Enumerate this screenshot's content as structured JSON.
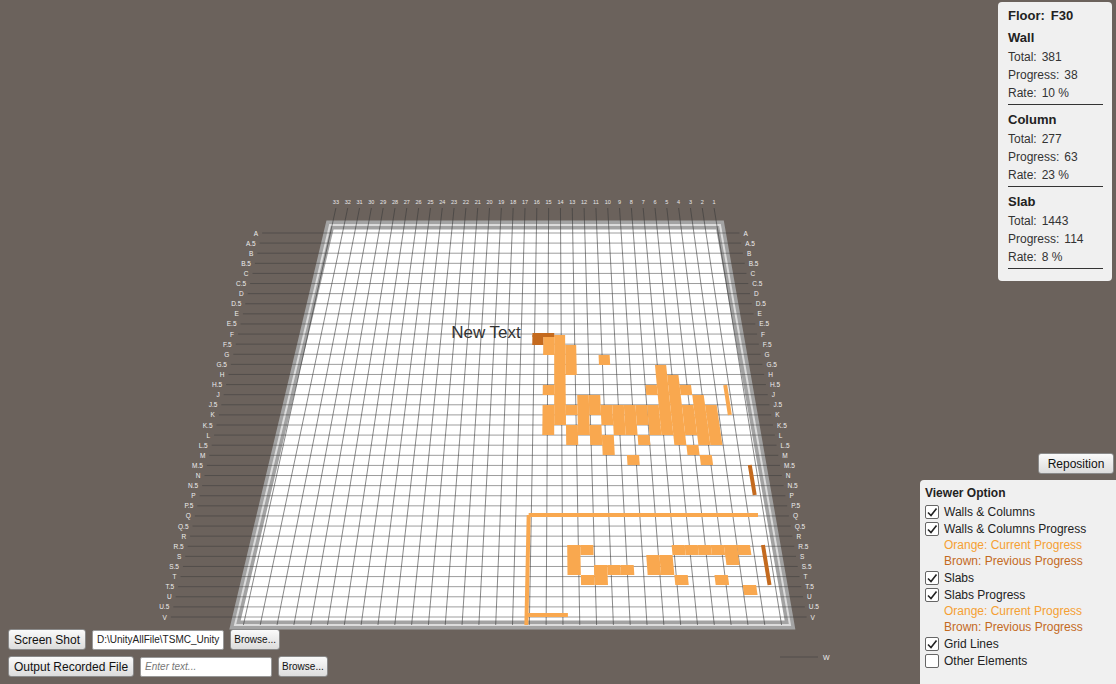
{
  "info_panel": {
    "floor_label": "Floor:",
    "floor": "F30",
    "sections": [
      {
        "title": "Wall",
        "stats": [
          {
            "label": "Total:",
            "value": "381"
          },
          {
            "label": "Progress:",
            "value": "38"
          },
          {
            "label": "Rate:",
            "value": "10 %"
          }
        ]
      },
      {
        "title": "Column",
        "stats": [
          {
            "label": "Total:",
            "value": "277"
          },
          {
            "label": "Progress:",
            "value": "63"
          },
          {
            "label": "Rate:",
            "value": "23 %"
          }
        ]
      },
      {
        "title": "Slab",
        "stats": [
          {
            "label": "Total:",
            "value": "1443"
          },
          {
            "label": "Progress:",
            "value": "114"
          },
          {
            "label": "Rate:",
            "value": "8 %"
          }
        ]
      }
    ]
  },
  "reposition_button": "Reposition",
  "viewer_option": {
    "title": "Viewer Option",
    "items": [
      {
        "kind": "checkbox",
        "label": "Walls & Columns",
        "checked": true
      },
      {
        "kind": "checkbox",
        "label": "Walls & Columns Progress",
        "checked": true
      },
      {
        "kind": "legend",
        "label": "Orange: Current Progress",
        "color": "#f5a033"
      },
      {
        "kind": "legend",
        "label": "Brown: Previous Progress",
        "color": "#c46a1e"
      },
      {
        "kind": "checkbox",
        "label": "Slabs",
        "checked": true
      },
      {
        "kind": "checkbox",
        "label": "Slabs Progress",
        "checked": true
      },
      {
        "kind": "legend",
        "label": "Orange: Current Progress",
        "color": "#f5a033"
      },
      {
        "kind": "legend",
        "label": "Brown: Previous Progress",
        "color": "#c46a1e"
      },
      {
        "kind": "checkbox",
        "label": "Grid Lines",
        "checked": true
      },
      {
        "kind": "checkbox",
        "label": "Other Elements",
        "checked": false
      }
    ]
  },
  "toolbar": {
    "screenshot_button": "Screen Shot",
    "path": "D:\\UnityAllFile\\TSMC_Unity",
    "browse_1": "Browse...",
    "output_button": "Output Recorded File",
    "output_placeholder": "Enter text...",
    "browse_2": "Browse..."
  },
  "viewport": {
    "floating_label": "New Text",
    "column_labels": [
      "33",
      "32",
      "31",
      "30",
      "29",
      "28",
      "27",
      "26",
      "25",
      "24",
      "23",
      "22",
      "21",
      "20",
      "19",
      "18",
      "17",
      "16",
      "15",
      "14",
      "13",
      "12",
      "11",
      "10",
      "9",
      "8",
      "7",
      "6",
      "5",
      "4",
      "3",
      "2",
      "1"
    ],
    "row_labels": [
      "A",
      "A.5",
      "B",
      "B.5",
      "C",
      "C.5",
      "D",
      "D.5",
      "E",
      "E.5",
      "F",
      "F.5",
      "G",
      "G.5",
      "H",
      "H.5",
      "J",
      "J.5",
      "K",
      "K.5",
      "L",
      "L.5",
      "M",
      "M.5",
      "N",
      "N.5",
      "P",
      "P.5",
      "Q",
      "Q.5",
      "R",
      "R.5",
      "S",
      "S.5",
      "T",
      "T.5",
      "U",
      "U.5",
      "V"
    ],
    "extra_row_label": "W",
    "slab_cells": [
      {
        "row": 11,
        "cols": [
          22,
          23
        ],
        "state": "current"
      },
      {
        "row": 12,
        "cols": [
          22,
          23,
          24
        ],
        "state": "current"
      },
      {
        "row": 13,
        "cols": [
          23,
          24,
          27
        ],
        "state": "current"
      },
      {
        "row": 14,
        "cols": [
          23,
          24,
          32
        ],
        "state": "current"
      },
      {
        "row": 15,
        "cols": [
          23,
          32,
          33
        ],
        "state": "current"
      },
      {
        "row": 16,
        "cols": [
          22,
          23,
          31,
          32,
          33,
          34
        ],
        "state": "current"
      },
      {
        "row": 17,
        "cols": [
          23,
          25,
          26,
          32,
          33,
          35
        ],
        "state": "current"
      },
      {
        "row": 18,
        "cols": [
          22,
          23,
          24,
          25,
          26,
          27,
          28,
          29,
          30,
          31,
          32,
          33,
          34,
          35,
          36
        ],
        "state": "current"
      },
      {
        "row": 19,
        "cols": [
          22,
          23,
          25,
          27,
          28,
          29,
          30,
          31,
          32,
          33,
          34,
          35,
          36
        ],
        "state": "current"
      },
      {
        "row": 20,
        "cols": [
          22,
          24,
          25,
          26,
          28,
          29,
          31,
          32,
          33,
          34,
          35,
          36
        ],
        "state": "current"
      },
      {
        "row": 21,
        "cols": [
          24,
          26,
          27,
          30,
          33,
          35,
          36
        ],
        "state": "current"
      },
      {
        "row": 22,
        "cols": [
          27,
          34
        ],
        "state": "current"
      },
      {
        "row": 23,
        "cols": [
          29,
          35
        ],
        "state": "current"
      },
      {
        "row": 32,
        "cols": [
          24,
          25,
          32,
          33,
          34,
          35,
          36,
          37
        ],
        "state": "current"
      },
      {
        "row": 33,
        "cols": [
          24,
          30,
          31,
          36
        ],
        "state": "current"
      },
      {
        "row": 34,
        "cols": [
          24,
          26,
          27,
          28,
          30,
          31
        ],
        "state": "current"
      },
      {
        "row": 35,
        "cols": [
          25,
          26,
          32,
          35
        ],
        "state": "current"
      },
      {
        "row": 36,
        "cols": [
          37
        ],
        "state": "current"
      },
      {
        "row": 11,
        "cols": [
          21
        ],
        "state": "previous"
      }
    ],
    "wall_marks": [
      {
        "col": 39,
        "row": 24,
        "length": 3,
        "direction": "v",
        "state": "previous"
      },
      {
        "col": 39,
        "row": 32,
        "length": 4,
        "direction": "v",
        "state": "previous"
      },
      {
        "col": 21,
        "row": 29,
        "length": 18,
        "direction": "h",
        "state": "current"
      },
      {
        "col": 21,
        "row": 29,
        "length": 11,
        "direction": "v",
        "state": "current"
      },
      {
        "col": 21,
        "row": 11,
        "length": 2,
        "direction": "h",
        "state": "previous"
      },
      {
        "col": 38,
        "row": 16,
        "length": 3,
        "direction": "v",
        "state": "current"
      },
      {
        "col": 21,
        "row": 39,
        "length": 3,
        "direction": "h",
        "state": "current"
      }
    ]
  }
}
